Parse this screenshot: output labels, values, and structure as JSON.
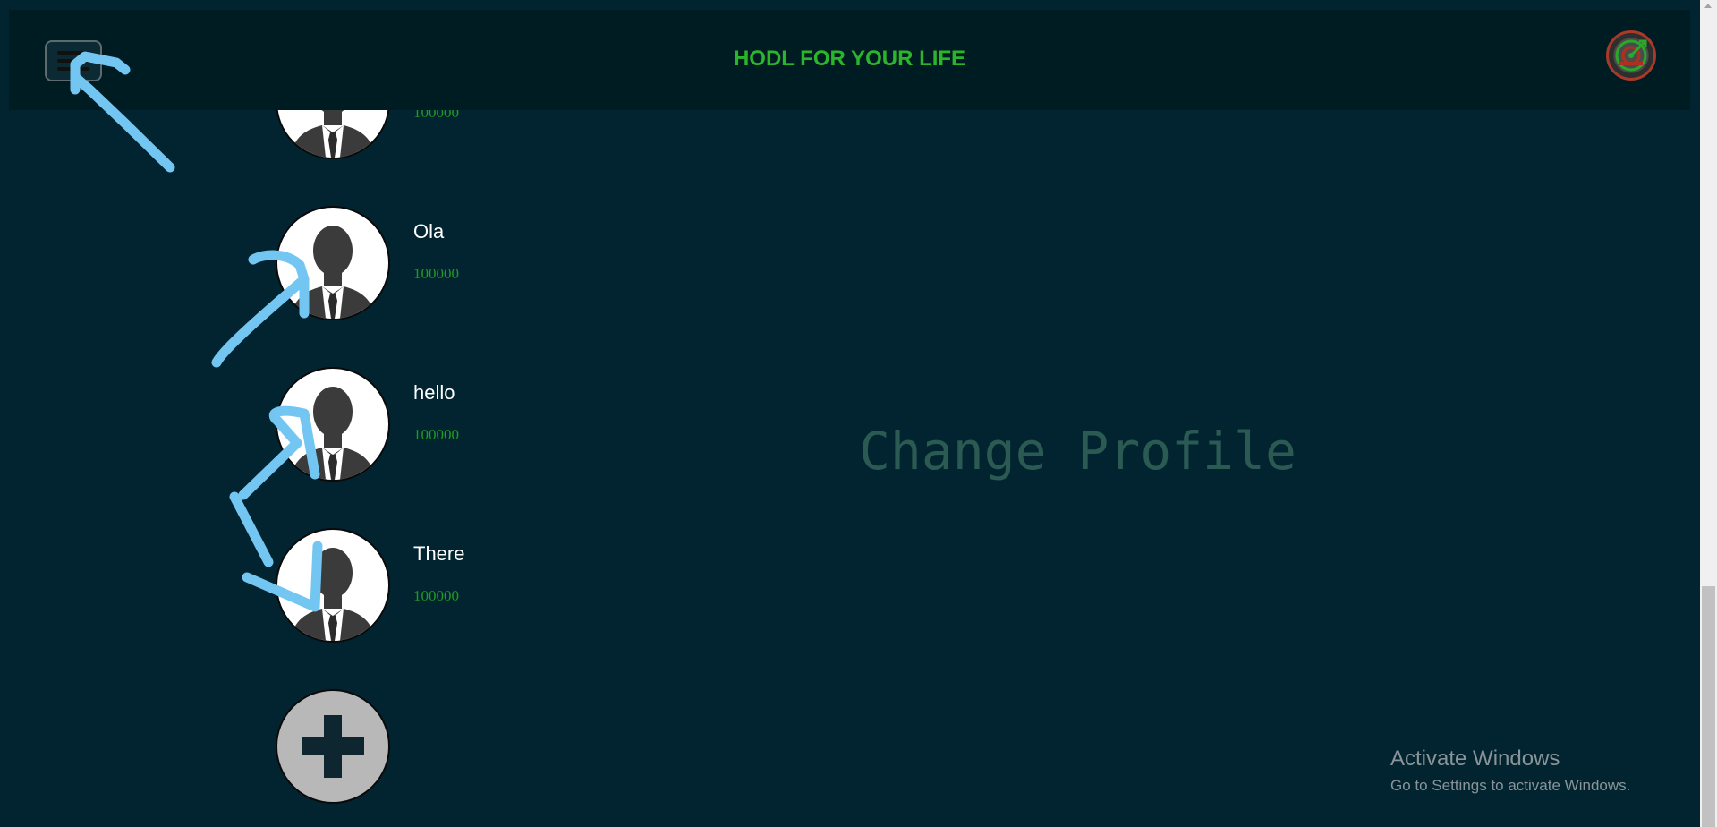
{
  "header": {
    "title": "HODL FOR YOUR LIFE",
    "menu_icon": "hamburger-menu-icon",
    "logo_icon": "app-logo-icon"
  },
  "profiles": [
    {
      "name": "",
      "balance": "100000"
    },
    {
      "name": "Ola",
      "balance": "100000"
    },
    {
      "name": "hello",
      "balance": "100000"
    },
    {
      "name": "There",
      "balance": "100000"
    }
  ],
  "add_profile": {
    "icon": "plus-icon"
  },
  "main": {
    "heading": "Change Profile"
  },
  "windows_watermark": {
    "title": "Activate Windows",
    "subtitle": "Go to Settings to activate Windows."
  },
  "colors": {
    "background": "#012430",
    "header_bg": "#001c23",
    "title_green": "#2bb52b",
    "balance_green": "#1f9b1f",
    "heading_color": "#2b5a52",
    "annotation_blue": "#74c6f2"
  }
}
